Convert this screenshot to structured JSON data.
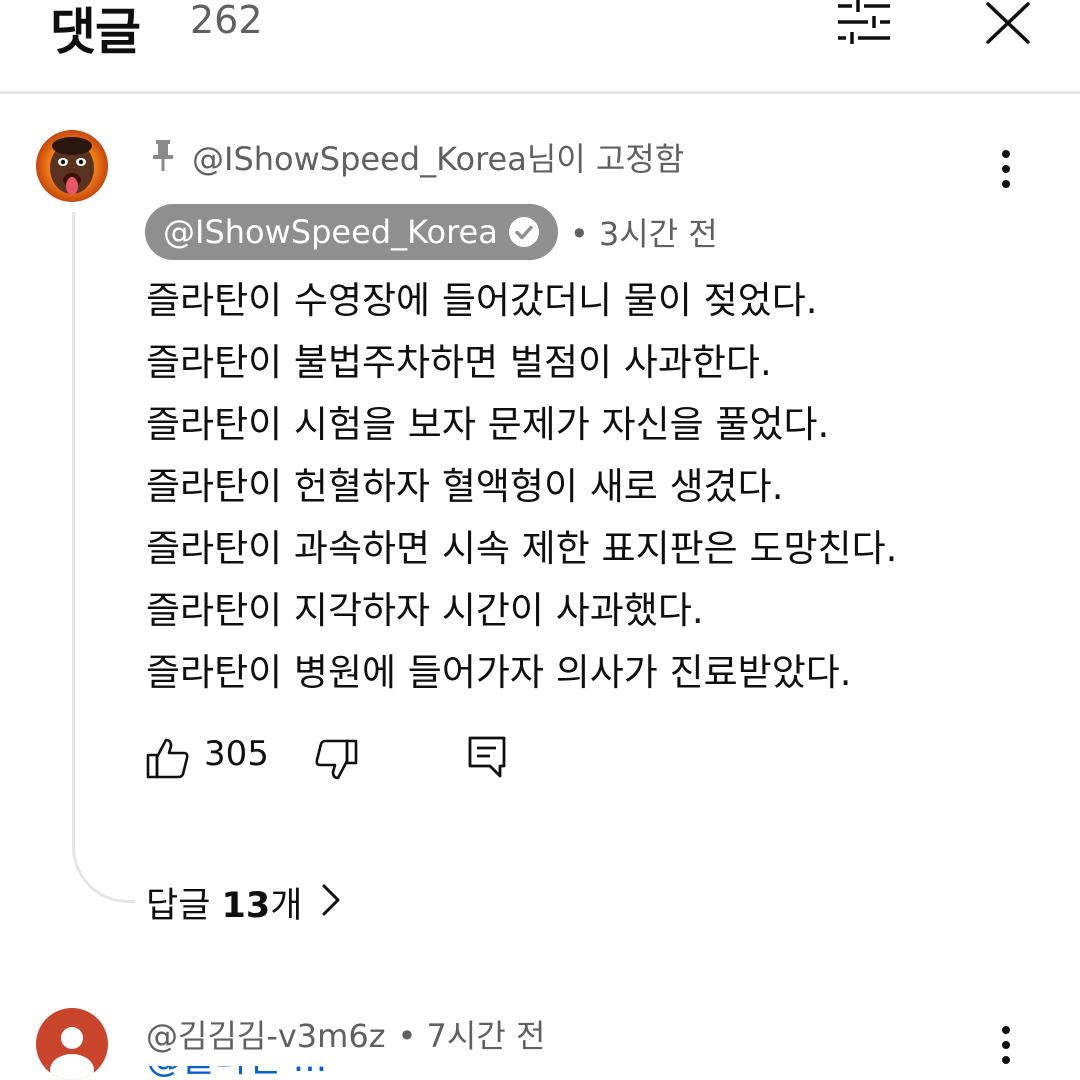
{
  "header": {
    "title": "댓글",
    "count": "262"
  },
  "pinned_comment": {
    "pinned_label": "@IShowSpeed_Korea님이 고정함",
    "author": "@IShowSpeed_Korea",
    "time": "• 3시간 전",
    "lines": [
      "즐라탄이 수영장에 들어갔더니 물이 젖었다.",
      "즐라탄이 불법주차하면 벌점이 사과한다.",
      "즐라탄이 시험을 보자 문제가 자신을 풀었다.",
      "즐라탄이 헌혈하자 혈액형이 새로 생겼다.",
      "즐라탄이 과속하면 시속 제한 표지판은 도망친다.",
      "즐라탄이 지각하자 시간이 사과했다.",
      "즐라탄이 병원에 들어가자 의사가 진료받았다."
    ],
    "likes": "305",
    "replies_prefix": "답글 ",
    "replies_count": "13",
    "replies_suffix": "개"
  },
  "second_comment": {
    "author": "@김김김-v3m6z",
    "time": "• 7시간 전",
    "partial_text": "@즐라탄 ..."
  },
  "colors": {
    "chip_bg": "#8f8f8f",
    "secondary_text": "#606060",
    "divider": "#e5e5e5",
    "avatar_kim": "#c9452e"
  },
  "icons": [
    "filter-icon",
    "close-icon",
    "pin-icon",
    "verified-icon",
    "more-vert-icon",
    "thumb-up-icon",
    "thumb-down-icon",
    "reply-icon",
    "chevron-right-icon"
  ]
}
